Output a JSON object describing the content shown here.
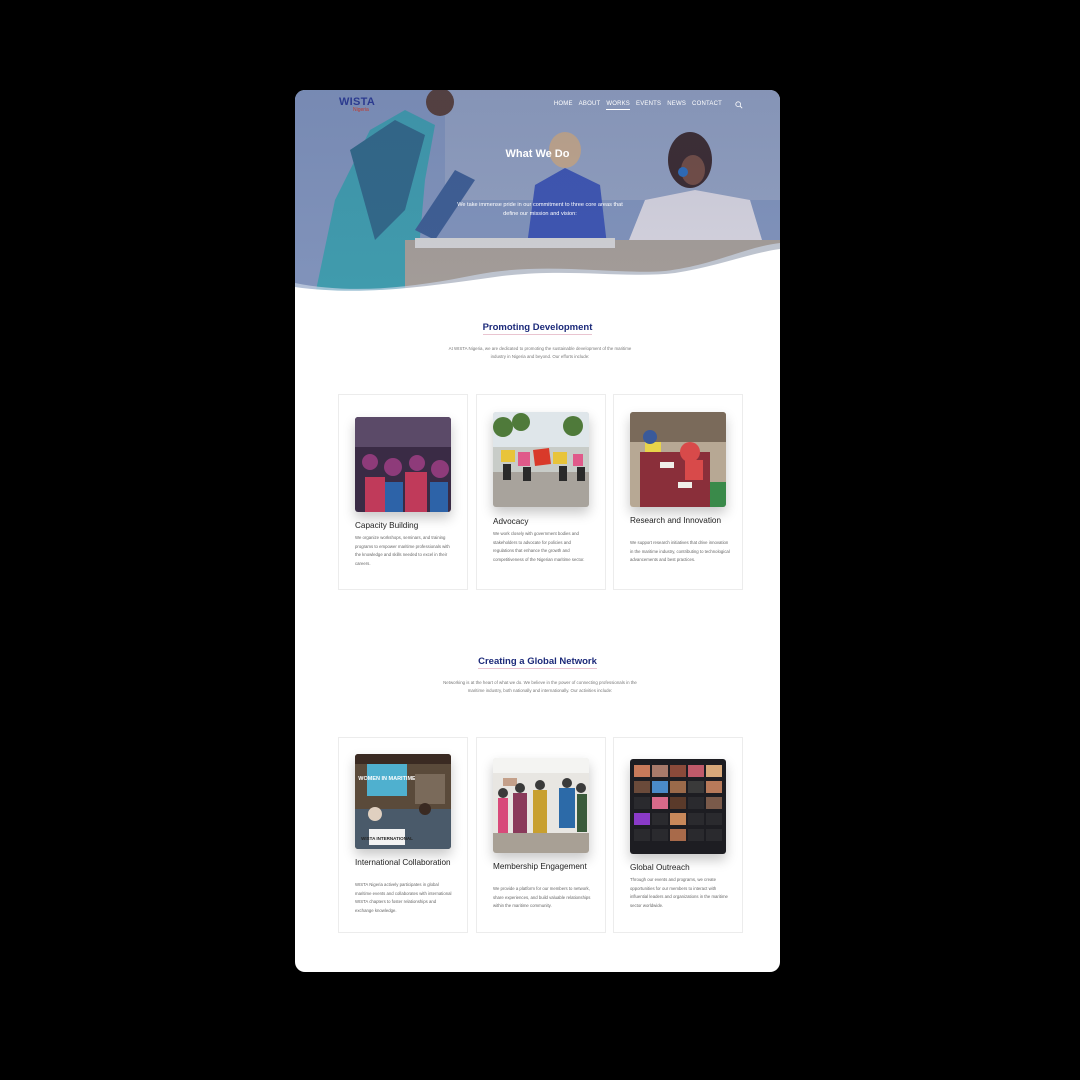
{
  "header": {
    "logo": "WISTA",
    "logo_sub": "Nigeria",
    "nav": [
      "HOME",
      "ABOUT",
      "WORKS",
      "EVENTS",
      "NEWS",
      "CONTACT"
    ],
    "active_nav": "WORKS",
    "search_icon": "search-icon"
  },
  "hero": {
    "title": "What We Do",
    "subtitle": "We take immense pride in our commitment to three core areas that define our mission and vision:"
  },
  "section1": {
    "title": "Promoting Development",
    "description": "At WISTA Nigeria, we are dedicated to promoting the sustainable development of the maritime industry in Nigeria and beyond. Our efforts include:",
    "cards": [
      {
        "title": "Capacity Building",
        "text": "We organize workshops, seminars, and training programs to empower maritime professionals with the knowledge and skills needed to excel in their careers."
      },
      {
        "title": "Advocacy",
        "text": "We work closely with government bodies and stakeholders to advocate for policies and regulations that enhance the growth and competitiveness of the Nigerian maritime sector."
      },
      {
        "title": "Research and Innovation",
        "text": "We support research initiatives that drive innovation in the maritime industry, contributing to technological advancements and best practices."
      }
    ]
  },
  "section2": {
    "title": "Creating a Global Network",
    "description": "Networking is at the heart of what we do. We believe in the power of connecting professionals in the maritime industry, both nationally and internationally. Our activities include:",
    "cards": [
      {
        "title": "International Collaboration",
        "text": "WISTA Nigeria actively participates in global maritime events and collaborates with international WISTA chapters to foster relationships and exchange knowledge."
      },
      {
        "title": "Membership Engagement",
        "text": "We provide a platform for our members to network, share experiences, and build valuable relationships within the maritime community."
      },
      {
        "title": "Global Outreach",
        "text": "Through our events and programs, we create opportunities for our members to interact with influential leaders and organizations in the maritime sector worldwide."
      }
    ],
    "image_texts": {
      "banner": "WOMEN IN MARITIME",
      "sign": "WISTA INTERNATIONAL"
    }
  }
}
